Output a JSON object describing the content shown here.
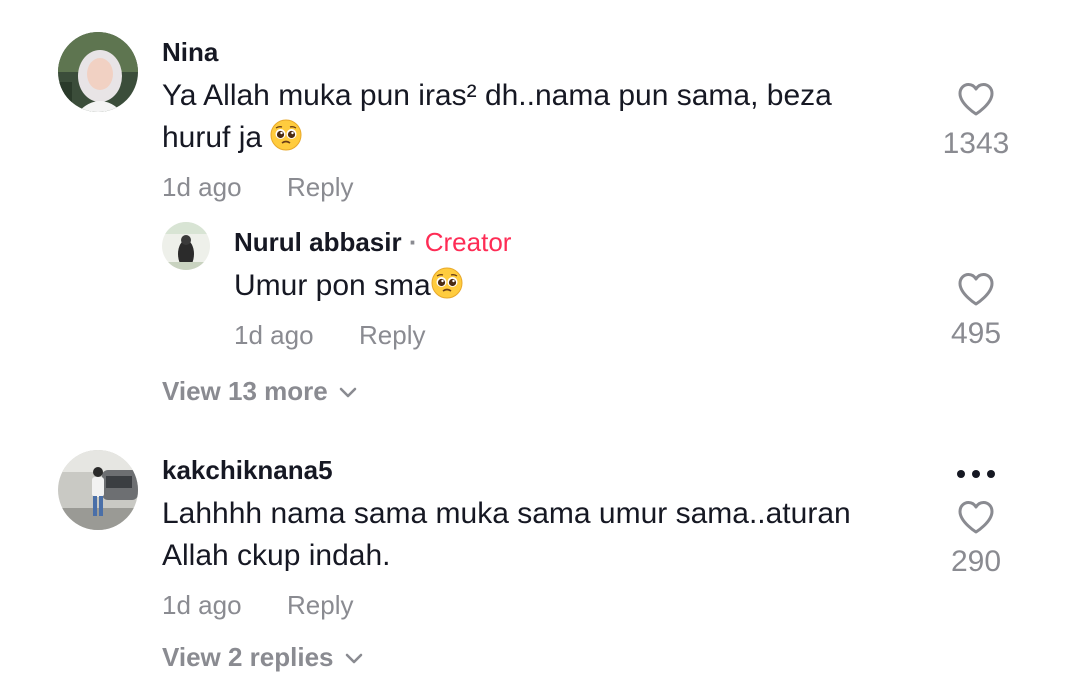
{
  "comments": [
    {
      "username": "Nina",
      "text_line1": "Ya Allah muka pun iras² dh..nama pun sama, beza",
      "text_line2": "huruf ja",
      "time": "1d ago",
      "reply_label": "Reply",
      "likes": "1343",
      "avatar_icon": "user-avatar-photo"
    },
    {
      "username": "kakchiknana5",
      "text_line1": "Lahhhh nama sama muka sama umur sama..aturan",
      "text_line2": "Allah ckup indah.",
      "time": "1d ago",
      "reply_label": "Reply",
      "likes": "290",
      "avatar_icon": "user-avatar-photo",
      "view_replies": "View 2 replies"
    }
  ],
  "reply": {
    "username": "Nurul abbasir",
    "separator": "·",
    "badge": "Creator",
    "text": "Umur pon sma",
    "time": "1d ago",
    "reply_label": "Reply",
    "likes": "495"
  },
  "view_more": "View 13 more",
  "icons": {
    "heart": "heart-outline-icon",
    "emoji": "pleading-face-emoji",
    "chevron": "chevron-down-icon",
    "more": "more-dots-icon"
  },
  "colors": {
    "accent": "#fe2c55",
    "secondary_text": "#8a8b91",
    "primary_text": "#161823"
  }
}
